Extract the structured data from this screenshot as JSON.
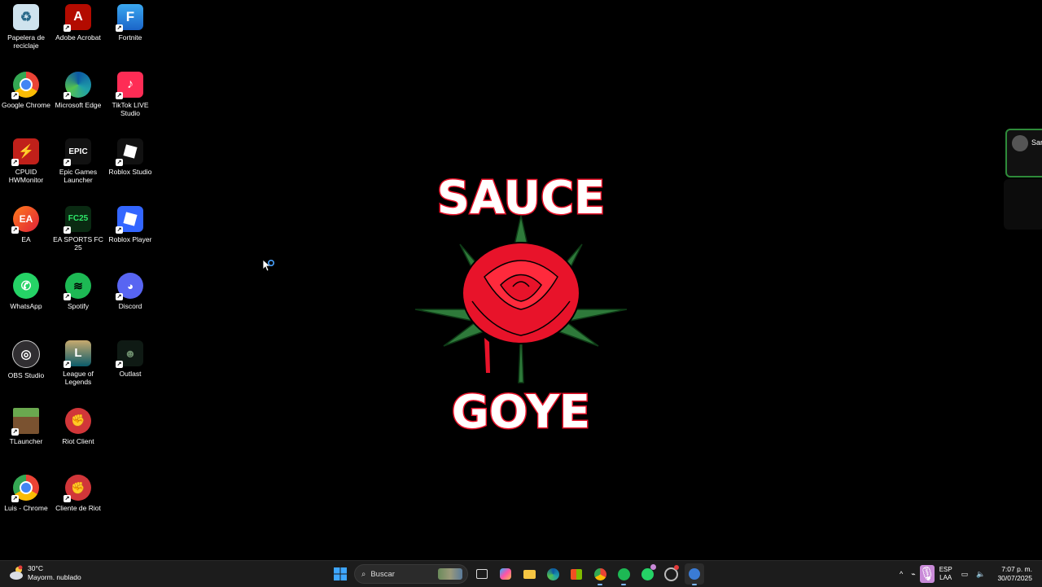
{
  "desktop": {
    "icons": [
      {
        "label": "Papelera de reciclaje",
        "icon": "recycle-bin-icon",
        "color": "#d8e8f0"
      },
      {
        "label": "Adobe Acrobat",
        "icon": "adobe-acrobat-icon",
        "color": "#b30b00"
      },
      {
        "label": "Fortnite",
        "icon": "fortnite-icon",
        "color": "#2a8ee8"
      },
      {
        "label": "Google Chrome",
        "icon": "chrome-icon",
        "color": "#4285f4"
      },
      {
        "label": "Microsoft Edge",
        "icon": "edge-icon",
        "color": "#1fa0a8"
      },
      {
        "label": "TikTok LIVE Studio",
        "icon": "tiktok-live-icon",
        "color": "#fe2c55"
      },
      {
        "label": "CPUID HWMonitor",
        "icon": "hwmonitor-icon",
        "color": "#c0201a"
      },
      {
        "label": "Epic Games Launcher",
        "icon": "epic-games-icon",
        "color": "#222222"
      },
      {
        "label": "Roblox Studio",
        "icon": "roblox-studio-icon",
        "color": "#1a1a1a"
      },
      {
        "label": "EA",
        "icon": "ea-icon",
        "color": "#ff4b2b"
      },
      {
        "label": "EA SPORTS FC 25",
        "icon": "ea-fc25-icon",
        "color": "#0a2a12"
      },
      {
        "label": "Roblox Player",
        "icon": "roblox-player-icon",
        "color": "#3366ff"
      },
      {
        "label": "WhatsApp",
        "icon": "whatsapp-icon",
        "color": "#25d366"
      },
      {
        "label": "Spotify",
        "icon": "spotify-icon",
        "color": "#1db954"
      },
      {
        "label": "Discord",
        "icon": "discord-icon",
        "color": "#5865f2"
      },
      {
        "label": "OBS Studio",
        "icon": "obs-studio-icon",
        "color": "#302e31"
      },
      {
        "label": "League of Legends",
        "icon": "league-of-legends-icon",
        "color": "#0a5a6a"
      },
      {
        "label": "Outlast",
        "icon": "outlast-icon",
        "color": "#0f1a14"
      },
      {
        "label": "TLauncher",
        "icon": "tlauncher-icon",
        "color": "#5a8a3a"
      },
      {
        "label": "Riot Client",
        "icon": "riot-client-icon",
        "color": "#d13639"
      },
      {
        "label": "Luis - Chrome",
        "icon": "chrome-profile-icon",
        "color": "#4285f4"
      },
      {
        "label": "Cliente de Riot",
        "icon": "riot-client-icon",
        "color": "#d13639"
      }
    ]
  },
  "logo": {
    "top_text": "SAUCE",
    "bottom_text": "GOYE"
  },
  "side_panel": {
    "label": "Sar"
  },
  "taskbar": {
    "weather_temp": "30°C",
    "weather_desc": "Mayorm. nublado",
    "search_placeholder": "Buscar",
    "lang_top": "ESP",
    "lang_bottom": "LAA",
    "time": "7:07 p. m.",
    "date": "30/07/2025",
    "colors": {
      "accent": "#7fb8ff",
      "mic": "#c98ad8"
    }
  }
}
